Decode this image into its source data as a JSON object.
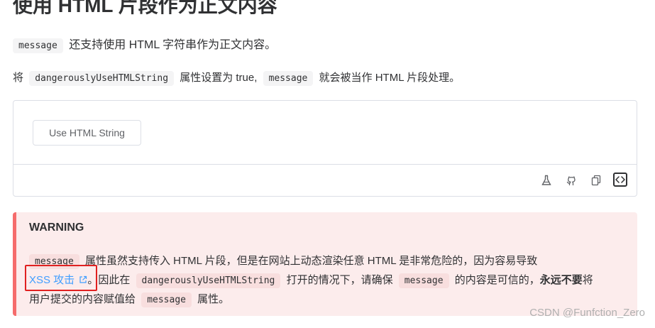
{
  "heading": "使用 HTML 片段作为正文内容",
  "para1": {
    "code": "message",
    "text": "还支持使用 HTML 字符串作为正文内容。"
  },
  "para2": {
    "prefix": "将",
    "code1": "dangerouslyUseHTMLString",
    "middle": "属性设置为 true,",
    "code2": "message",
    "suffix": "就会被当作 HTML 片段处理。"
  },
  "demo": {
    "button_label": "Use HTML String",
    "tools": [
      "flask-icon",
      "github-icon",
      "copy-icon",
      "code-icon"
    ]
  },
  "warning": {
    "title": "WARNING",
    "line1_code": "message",
    "line1_text": "属性虽然支持传入 HTML 片段，但是在网站上动态渲染任意 HTML 是非常危险的，因为容易导致",
    "link_text": "XSS 攻击",
    "line2_a": "。因此在",
    "line2_code1": "dangerouslyUseHTMLString",
    "line2_b": "打开的情况下，请确保",
    "line2_code2": "message",
    "line2_c": "的内容是可信的，",
    "line2_bold": "永远不要",
    "line2_d": "将",
    "line3_a": "用户提交的内容赋值给",
    "line3_code": "message",
    "line3_b": "属性。"
  },
  "watermark": "CSDN @Funfction_Zero",
  "colors": {
    "accent": "#409eff",
    "warning_border": "#f56c6c",
    "warning_bg": "#fcecec",
    "highlight_frame": "#e02020"
  }
}
